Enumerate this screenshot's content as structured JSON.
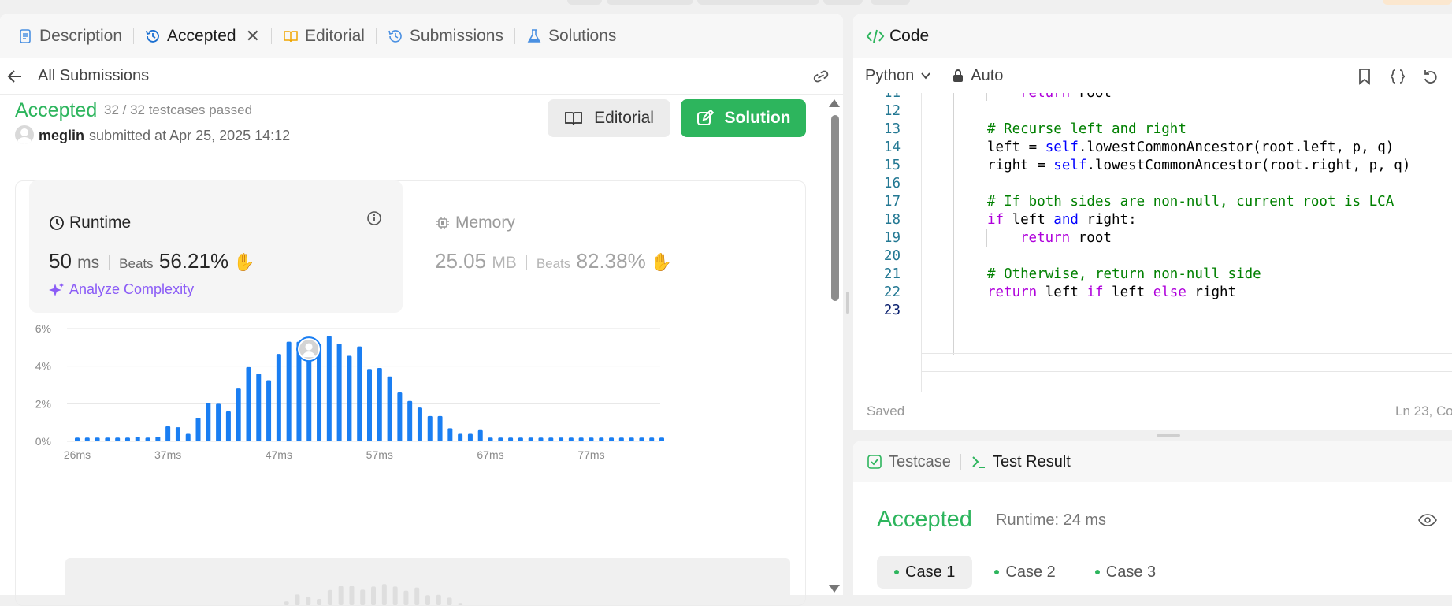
{
  "tabs": {
    "description": "Description",
    "accepted": "Accepted",
    "editorial": "Editorial",
    "submissions": "Submissions",
    "solutions": "Solutions"
  },
  "subheader": {
    "back_label": "All Submissions"
  },
  "submission": {
    "status": "Accepted",
    "testcases": "32 / 32 testcases passed",
    "user": "meglin",
    "submitted_at": "submitted at Apr 25, 2025 14:12",
    "editorial_button": "Editorial",
    "solution_button": "Solution"
  },
  "runtime": {
    "label": "Runtime",
    "value": "50",
    "unit": "ms",
    "beats_label": "Beats",
    "beats": "56.21%",
    "analyze": "Analyze Complexity"
  },
  "memory": {
    "label": "Memory",
    "value": "25.05",
    "unit": "MB",
    "beats_label": "Beats",
    "beats": "82.38%"
  },
  "chart_data": {
    "type": "bar",
    "ytick_labels": [
      "0%",
      "2%",
      "4%",
      "6%"
    ],
    "ylim": [
      0,
      6
    ],
    "xtick_labels": [
      "26ms",
      "37ms",
      "47ms",
      "57ms",
      "67ms",
      "77ms"
    ],
    "xtick_index": [
      0,
      9,
      20,
      30,
      41,
      51
    ],
    "values": [
      0.2,
      0.2,
      0.2,
      0.2,
      0.2,
      0.2,
      0.25,
      0.2,
      0.25,
      0.8,
      0.75,
      0.4,
      1.25,
      2.05,
      2.0,
      1.6,
      2.85,
      3.95,
      3.6,
      3.25,
      4.65,
      5.3,
      5.3,
      4.7,
      5.2,
      5.6,
      5.2,
      4.55,
      5.05,
      3.85,
      3.9,
      3.45,
      2.6,
      2.15,
      1.8,
      1.35,
      1.35,
      0.7,
      0.4,
      0.4,
      0.6,
      0.2,
      0.2,
      0.2,
      0.2,
      0.2,
      0.2,
      0.2,
      0.2,
      0.2,
      0.2,
      0.2,
      0.2,
      0.2,
      0.2,
      0.2,
      0.2,
      0.2,
      0.2
    ],
    "highlight_index": 24,
    "bar_color": "#1a7ef2",
    "grid": true
  },
  "code": {
    "title": "Code",
    "language": "Python",
    "mode": "Auto",
    "saved": "Saved",
    "cursor": "Ln 23, Co",
    "lines": [
      {
        "n": "11",
        "text": ""
      },
      {
        "n": "12",
        "text": ""
      },
      {
        "n": "13",
        "text": "# Recurse left and right"
      },
      {
        "n": "14",
        "text": ""
      },
      {
        "n": "15",
        "text": ""
      },
      {
        "n": "16",
        "text": ""
      },
      {
        "n": "17",
        "text": "# If both sides are non-null, current root is LCA"
      },
      {
        "n": "18",
        "text": ""
      },
      {
        "n": "19",
        "text": ""
      },
      {
        "n": "20",
        "text": ""
      },
      {
        "n": "21",
        "text": "# Otherwise, return non-null side"
      },
      {
        "n": "22",
        "text": ""
      },
      {
        "n": "23",
        "text": ""
      }
    ],
    "l11_kw": "return",
    "l11_rest": " root",
    "l14_a": "left = ",
    "l14_self": "self",
    "l14_b": ".lowestCommonAncestor(root.left, p, q)",
    "l15_a": "right = ",
    "l15_self": "self",
    "l15_b": ".lowestCommonAncestor(root.right, p, q)",
    "l18_if": "if",
    "l18_a": " left ",
    "l18_and": "and",
    "l18_b": " right:",
    "l19_kw": "return",
    "l19_rest": " root",
    "l22_ret": "return",
    "l22_a": " left ",
    "l22_if": "if",
    "l22_b": " left ",
    "l22_else": "else",
    "l22_c": " right"
  },
  "test": {
    "testcase_tab": "Testcase",
    "result_tab": "Test Result",
    "status": "Accepted",
    "runtime": "Runtime: 24 ms",
    "cases": [
      "Case 1",
      "Case 2",
      "Case 3"
    ]
  },
  "colors": {
    "accent_green": "#2db55d",
    "chart_blue": "#1a7ef2",
    "analyze_purple": "#8b5cf6"
  }
}
